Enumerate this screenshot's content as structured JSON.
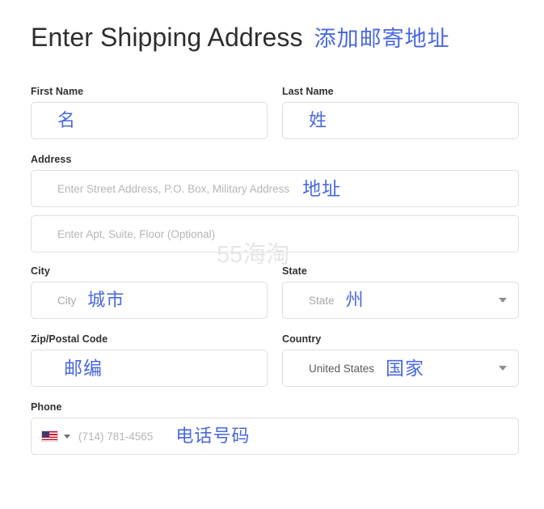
{
  "header": {
    "title_en": "Enter Shipping Address",
    "title_cn": "添加邮寄地址"
  },
  "colors": {
    "annotation_blue": "#4a68df",
    "label_dark": "#303030",
    "placeholder_gray": "#b6b6b6",
    "border_gray": "#dfdfdf",
    "watermark_gray": "#e6e6e6"
  },
  "watermark": {
    "text": "55海淘"
  },
  "fields": {
    "first_name": {
      "label": "First Name",
      "placeholder": "",
      "value": "",
      "annotation": "名"
    },
    "last_name": {
      "label": "Last Name",
      "placeholder": "",
      "value": "",
      "annotation": "姓"
    },
    "address": {
      "label": "Address",
      "placeholder": "Enter Street Address, P.O. Box, Military Address",
      "value": "",
      "annotation": "地址"
    },
    "address2": {
      "label": "",
      "placeholder": "Enter Apt, Suite, Floor (Optional)",
      "value": "",
      "annotation": ""
    },
    "city": {
      "label": "City",
      "placeholder": "City",
      "value": "",
      "annotation": "城市"
    },
    "state": {
      "label": "State",
      "placeholder": "State",
      "value": "",
      "annotation": "州",
      "caret": "chevron-down-icon"
    },
    "zip": {
      "label": "Zip/Postal Code",
      "placeholder": "",
      "value": "",
      "annotation": "邮编"
    },
    "country": {
      "label": "Country",
      "placeholder": "",
      "value": "United States",
      "annotation": "国家",
      "caret": "chevron-down-icon"
    },
    "phone": {
      "label": "Phone",
      "placeholder": "(714) 781-4565",
      "value": "",
      "annotation": "电话号码",
      "flag": "us-flag-icon",
      "flag_caret": "chevron-down-icon"
    }
  }
}
